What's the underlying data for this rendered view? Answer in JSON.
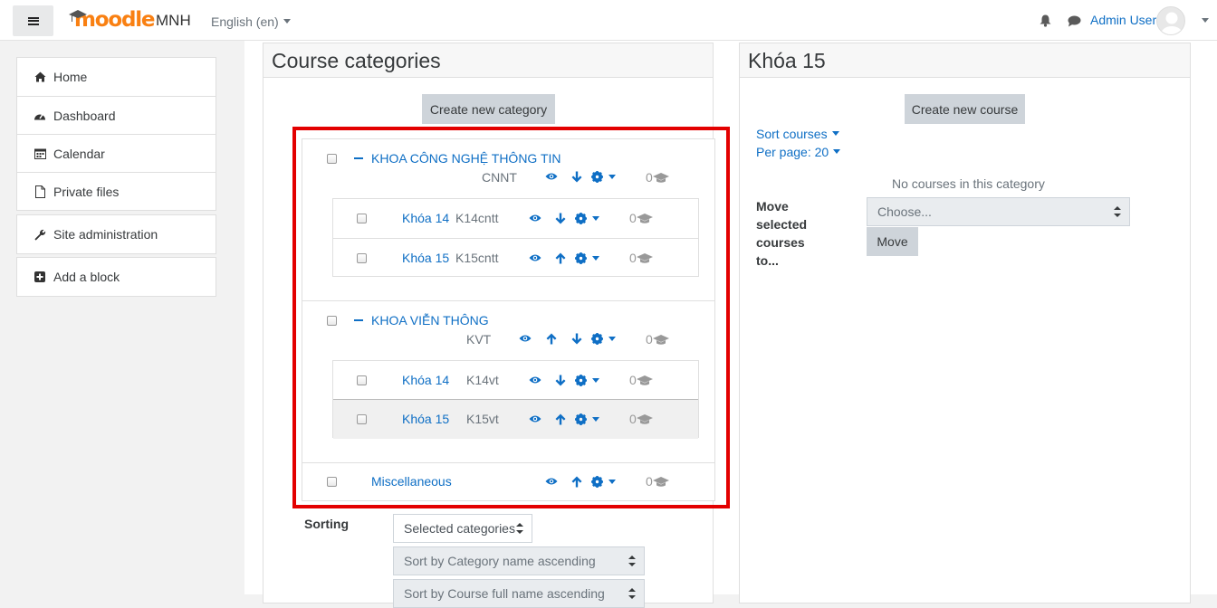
{
  "navbar": {
    "site_name": "MNH",
    "logo_text": "moodle",
    "language": "English (en)",
    "user_name": "Admin User",
    "icons": [
      "hamburger-icon",
      "bell-icon",
      "chat-icon",
      "avatar-icon"
    ]
  },
  "drawer": {
    "items": [
      {
        "label": "Home",
        "icon": "home-icon"
      },
      {
        "label": "Dashboard",
        "icon": "dashboard-icon"
      },
      {
        "label": "Calendar",
        "icon": "calendar-icon"
      },
      {
        "label": "Private files",
        "icon": "file-icon"
      }
    ],
    "site_admin": "Site administration",
    "add_block": "Add a block"
  },
  "categories_panel": {
    "title": "Course categories",
    "create_button": "Create new category",
    "categories": [
      {
        "name": "KHOA CÔNG NGHỆ THÔNG TIN",
        "idnumber": "CNNT",
        "count": "0",
        "children": [
          {
            "name": "Khóa 14",
            "idnumber": "K14cntt",
            "count": "0"
          },
          {
            "name": "Khóa 15",
            "idnumber": "K15cntt",
            "count": "0"
          }
        ]
      },
      {
        "name": "KHOA VIỄN THÔNG",
        "idnumber": "KVT",
        "count": "0",
        "children": [
          {
            "name": "Khóa 14",
            "idnumber": "K14vt",
            "count": "0"
          },
          {
            "name": "Khóa 15",
            "idnumber": "K15vt",
            "count": "0"
          }
        ]
      },
      {
        "name": "Miscellaneous",
        "idnumber": "",
        "count": "0"
      }
    ],
    "sorting_label": "Sorting",
    "sort_scope": "Selected categories",
    "sort_category": "Sort by Category name ascending",
    "sort_course": "Sort by Course full name ascending"
  },
  "courses_panel": {
    "title": "Khóa 15",
    "create_button": "Create new course",
    "sort_courses": "Sort courses",
    "per_page": "Per page: 20",
    "empty_text": "No courses in this category",
    "move_label": "Move selected courses to...",
    "move_placeholder": "Choose...",
    "move_button": "Move"
  },
  "colors": {
    "accent": "#0f6fc5",
    "brand": "#f98012",
    "highlight": "#e30000"
  }
}
